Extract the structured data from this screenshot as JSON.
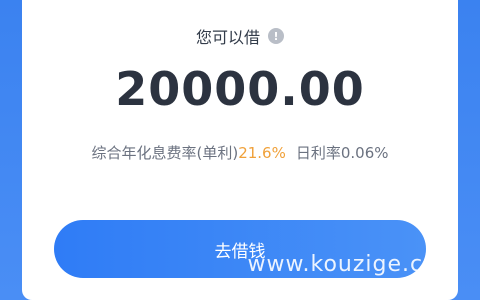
{
  "header": {
    "title": "您可以借",
    "info_icon": "info-circle-icon",
    "info_glyph": "!"
  },
  "amount": "20000.00",
  "rates": {
    "annual_label": "综合年化息费率(单利)",
    "annual_value": "21.6%",
    "daily_label": "日利率",
    "daily_value": "0.06%"
  },
  "action": {
    "borrow_label": "去借钱"
  },
  "watermark": "www.kouzige.com",
  "colors": {
    "accent": "#3b82f0",
    "highlight": "#f0a13a",
    "amount_text": "#2c3340"
  }
}
